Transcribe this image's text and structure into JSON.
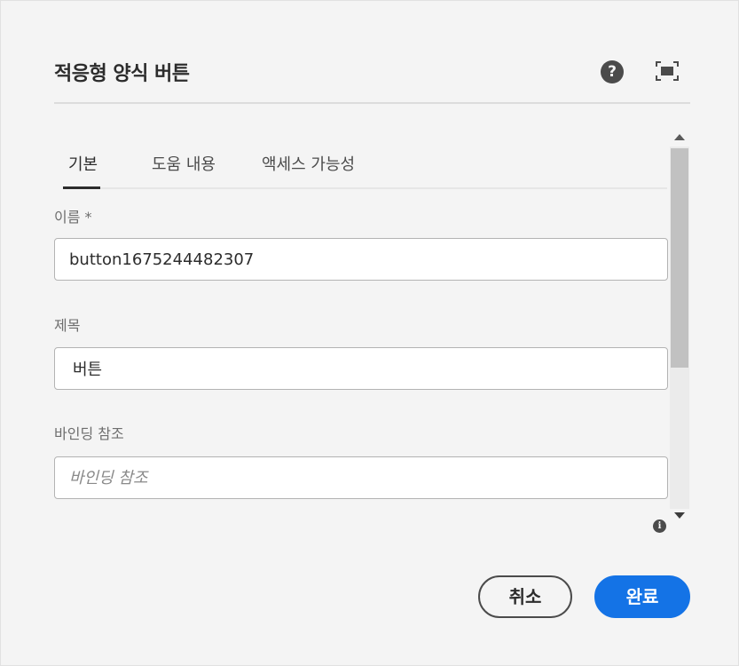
{
  "dialog": {
    "title": "적응형 양식 버튼",
    "help_icon": "help-circle-icon",
    "fullscreen_icon": "fullscreen-icon"
  },
  "tabs": [
    {
      "label": "기본",
      "active": true
    },
    {
      "label": "도움 내용",
      "active": false
    },
    {
      "label": "액세스 가능성",
      "active": false
    }
  ],
  "fields": {
    "name": {
      "label": "이름 *",
      "value": "button1675244482307"
    },
    "title": {
      "label": "제목",
      "value": "버튼"
    },
    "binding_ref": {
      "label": "바인딩 참조",
      "value": "",
      "placeholder": "바인딩 참조"
    }
  },
  "footer": {
    "cancel_label": "취소",
    "done_label": "완료"
  },
  "colors": {
    "primary": "#1473e6",
    "background": "#f4f4f4"
  }
}
